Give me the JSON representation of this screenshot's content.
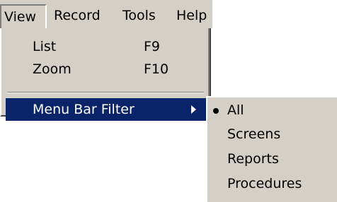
{
  "menubar": {
    "items": [
      {
        "label": "View",
        "active": true
      },
      {
        "label": "Record",
        "active": false
      },
      {
        "label": "Tools",
        "active": false
      },
      {
        "label": "Help",
        "active": false
      }
    ]
  },
  "view_menu": {
    "items": [
      {
        "label": "List",
        "shortcut": "F9"
      },
      {
        "label": "Zoom",
        "shortcut": "F10"
      },
      {
        "label": "Menu Bar Filter",
        "has_submenu": true,
        "highlighted": true
      }
    ]
  },
  "filter_submenu": {
    "selected": "All",
    "items": [
      {
        "label": "All",
        "checked": true
      },
      {
        "label": "Screens",
        "checked": false
      },
      {
        "label": "Reports",
        "checked": false
      },
      {
        "label": "Procedures",
        "checked": false
      }
    ]
  },
  "colors": {
    "menu_face": "#d4d0c8",
    "highlight": "#0a246a",
    "highlight_text": "#ffffff"
  }
}
